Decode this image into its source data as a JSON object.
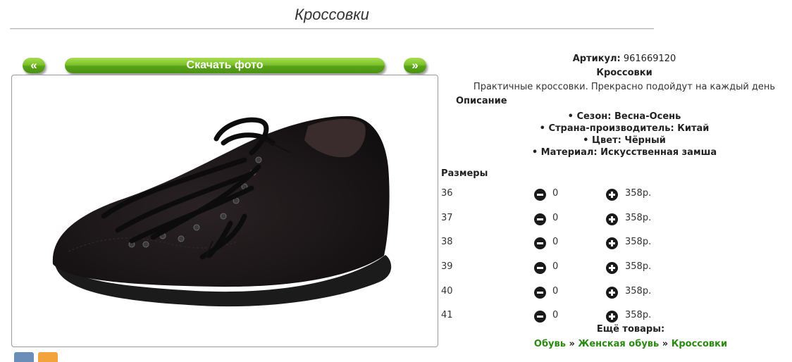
{
  "page": {
    "title": "Кроссовки"
  },
  "gallery": {
    "prev_label": "«",
    "download_label": "Скачать фото",
    "next_label": "»"
  },
  "product": {
    "article_label": "Артикул:",
    "article_value": "961669120",
    "name": "Кроссовки",
    "lead": "Практичные кроссовки. Прекрасно подойдут на каждый день",
    "description_heading": "Описание",
    "features": [
      "Сезон: Весна-Осень",
      "Страна-производитель: Китай",
      "Цвет: Чёрный",
      "Материал: Искусственная замша"
    ],
    "sizes_heading": "Размеры",
    "sizes": [
      {
        "size": "36",
        "qty": "0",
        "price": "358р."
      },
      {
        "size": "37",
        "qty": "0",
        "price": "358р."
      },
      {
        "size": "38",
        "qty": "0",
        "price": "358р."
      },
      {
        "size": "39",
        "qty": "0",
        "price": "358р."
      },
      {
        "size": "40",
        "qty": "0",
        "price": "358р."
      },
      {
        "size": "41",
        "qty": "0",
        "price": "358р."
      }
    ]
  },
  "more": {
    "heading": "Ещё товары:",
    "crumbs": [
      "Обувь",
      "Женская обувь",
      "Кроссовки"
    ],
    "separator": "»"
  },
  "colors": {
    "button_green": "#6cb520",
    "link_green": "#2a8a12",
    "icon_dark": "#1a1a1a"
  },
  "icons": [
    "minus-circle-icon",
    "plus-circle-icon",
    "vk-share-icon",
    "ok-share-icon"
  ]
}
